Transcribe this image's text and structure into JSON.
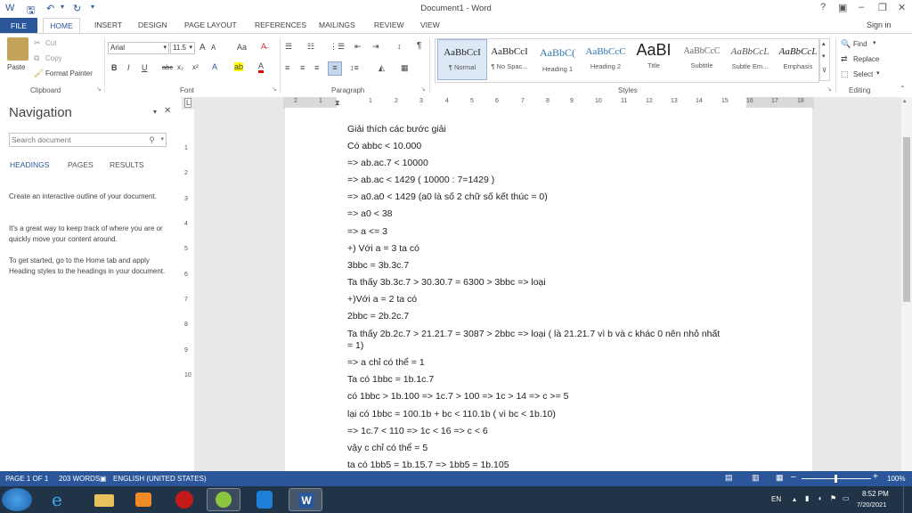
{
  "window": {
    "title": "Document1 - Word",
    "sign_in": "Sign in",
    "help_icon": "question-icon",
    "buttons": [
      "?",
      "▣",
      "–",
      "❐",
      "✕"
    ]
  },
  "tabs": [
    "FILE",
    "HOME",
    "INSERT",
    "DESIGN",
    "PAGE LAYOUT",
    "REFERENCES",
    "MAILINGS",
    "REVIEW",
    "VIEW"
  ],
  "ribbon": {
    "clipboard": {
      "paste": "Paste",
      "cut": "Cut",
      "copy": "Copy",
      "format_painter": "Format Painter",
      "label": "Clipboard"
    },
    "font": {
      "name": "Arial",
      "size": "11.5",
      "grow": "A",
      "shrink": "A",
      "case": "Aa",
      "bold": "B",
      "italic": "I",
      "underline": "U",
      "strike": "abc",
      "sub": "x₂",
      "sup": "x²",
      "label": "Font"
    },
    "paragraph": {
      "label": "Paragraph",
      "pilcrow": "¶"
    },
    "styles": {
      "label": "Styles",
      "items": [
        {
          "sample": "AaBbCcI",
          "name": "¶ Normal"
        },
        {
          "sample": "AaBbCcI",
          "name": "¶ No Spac..."
        },
        {
          "sample": "AaBbC(",
          "name": "Heading 1"
        },
        {
          "sample": "AaBbCcC",
          "name": "Heading 2"
        },
        {
          "sample": "AaBI",
          "name": "Title"
        },
        {
          "sample": "AaBbCcC",
          "name": "Subtitle"
        },
        {
          "sample": "AaBbCcL",
          "name": "Subtle Em..."
        },
        {
          "sample": "AaBbCcL",
          "name": "Emphasis"
        }
      ]
    },
    "editing": {
      "find": "Find",
      "replace": "Replace",
      "select": "Select",
      "label": "Editing"
    }
  },
  "navigation": {
    "title": "Navigation",
    "search_placeholder": "Search document",
    "tabs": [
      "HEADINGS",
      "PAGES",
      "RESULTS"
    ],
    "paragraphs": [
      "Create an interactive outline of your document.",
      "It's a great way to keep track of where you are or quickly move your content around.",
      "To get started, go to the Home tab and apply Heading styles to the headings in your document."
    ]
  },
  "ruler": {
    "h_numbers": [
      "2",
      "1",
      "1",
      "2",
      "3",
      "4",
      "5",
      "6",
      "7",
      "8",
      "9",
      "10",
      "11",
      "12",
      "13",
      "14",
      "15",
      "16",
      "17",
      "18"
    ],
    "v_numbers": [
      "1",
      "2",
      "3",
      "4",
      "5",
      "6",
      "7",
      "8",
      "9",
      "10"
    ]
  },
  "document": {
    "lines": [
      "Giải thích các bước giải",
      "Có abbc < 10.000",
      "=> ab.ac.7 < 10000",
      "=> ab.ac < 1429 ( 10000 : 7=1429 )",
      "=> a0.a0 < 1429 (a0 là số 2 chữ số kết thúc = 0)",
      "=> a0 < 38",
      "=> a <= 3",
      "+) Với a = 3 ta có",
      "3bbc = 3b.3c.7",
      "Ta thấy 3b.3c.7 > 30.30.7 = 6300 > 3bbc => loại",
      "+)Với a = 2 ta có",
      "2bbc = 2b.2c.7",
      "Ta thấy 2b.2c.7 > 21.21.7 = 3087 > 2bbc => loại ( là 21.21.7 vì b và c khác 0 nên nhỏ nhất",
      "= 1)",
      "=> a chỉ có thể = 1",
      "Ta có 1bbc = 1b.1c.7",
      "có 1bbc > 1b.100 => 1c.7 > 100 => 1c > 14 => c >= 5",
      "lại có 1bbc = 100.1b + bc < 110.1b ( vì bc < 1b.10)",
      "=> 1c.7 < 110 => 1c < 16 => c < 6",
      "vậy c chỉ có thể = 5",
      "ta có 1bb5 = 1b.15.7 => 1bb5 = 1b.105"
    ]
  },
  "status": {
    "page": "PAGE 1 OF 1",
    "words": "203 WORDS",
    "language": "ENGLISH (UNITED STATES)",
    "zoom": "100%",
    "minus": "–",
    "plus": "+"
  },
  "taskbar": {
    "lang": "EN",
    "time": "8:52 PM",
    "date": "7/20/2021",
    "apps": [
      "start-orb-icon",
      "ie-icon",
      "folder-icon",
      "media-player-icon",
      "red-app-icon",
      "green-app-icon",
      "shield-app-icon",
      "word-icon"
    ]
  },
  "colors": {
    "accent": "#2b579a",
    "taskbar": "#203347"
  }
}
